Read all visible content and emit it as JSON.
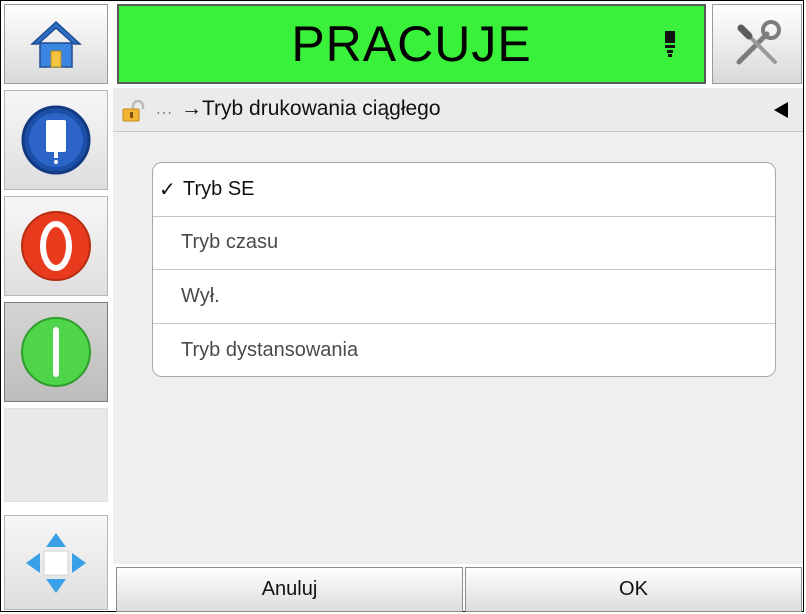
{
  "header": {
    "status_text": "PRACUJE",
    "status_color": "#39f03a",
    "home_icon": "home-icon",
    "tools_icon": "tools-icon",
    "ink_icon": "printhead-icon"
  },
  "sidebar": {
    "items": [
      {
        "name": "ink-cartridge-icon"
      },
      {
        "name": "stop-icon"
      },
      {
        "name": "start-icon"
      },
      {
        "name": "empty"
      },
      {
        "name": "navigation-arrows-icon"
      }
    ]
  },
  "breadcrumb": {
    "ellipsis": "…",
    "title": "→Tryb drukowania ciągłego"
  },
  "options": {
    "items": [
      {
        "label": "Tryb SE",
        "selected": true
      },
      {
        "label": "Tryb czasu",
        "selected": false
      },
      {
        "label": "Wył.",
        "selected": false
      },
      {
        "label": "Tryb dystansowania",
        "selected": false
      }
    ],
    "check_glyph": "✓"
  },
  "footer": {
    "cancel_label": "Anuluj",
    "ok_label": "OK"
  }
}
